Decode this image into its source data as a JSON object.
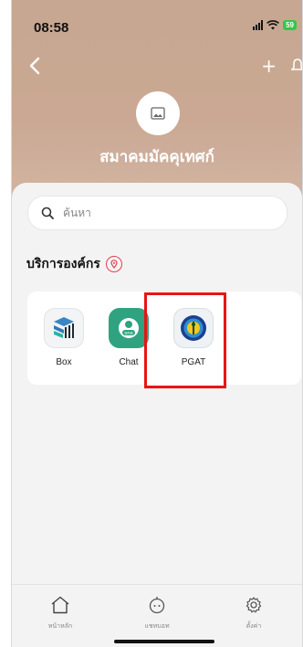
{
  "status_bar": {
    "time": "08:58",
    "battery": "59"
  },
  "header": {
    "org_name": "สมาคมมัคคุเทศก์",
    "plus": "+"
  },
  "search": {
    "placeholder": "ค้นหา"
  },
  "section": {
    "title": "บริการองค์กร"
  },
  "services": [
    {
      "label": "Box",
      "icon": "box-app-icon"
    },
    {
      "label": "Chat",
      "icon": "chat-app-icon"
    },
    {
      "label": "PGAT",
      "icon": "pgat-app-icon"
    }
  ],
  "tabbar": {
    "items": [
      {
        "label": "หน้าหลัก",
        "icon": "home-icon"
      },
      {
        "label": "แชทบอท",
        "icon": "chatbot-icon"
      },
      {
        "label": "ตั้งค่า",
        "icon": "settings-icon"
      }
    ]
  },
  "colors": {
    "header": "#c7a791",
    "accent_red": "#e0414b",
    "highlight": "#e81414",
    "chat_green": "#2fa37f",
    "battery": "#33c748"
  }
}
